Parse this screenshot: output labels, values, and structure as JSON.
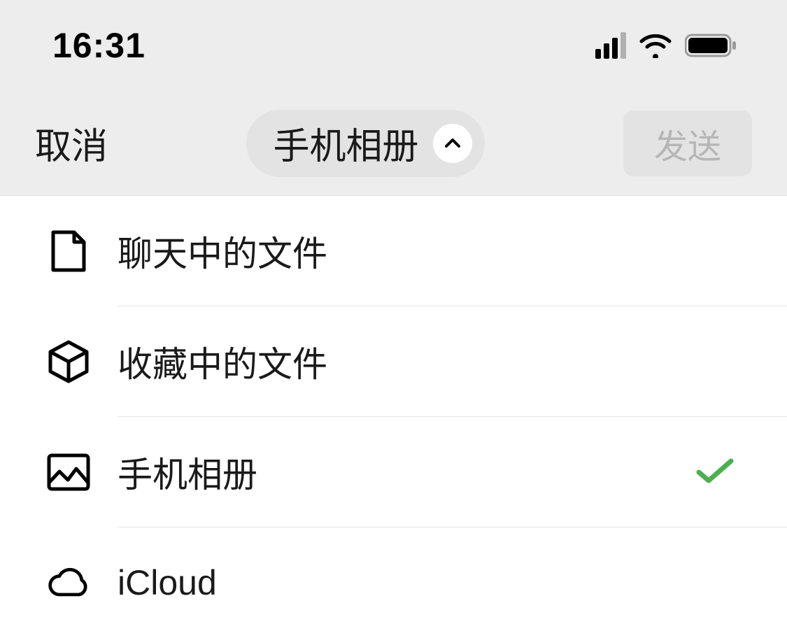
{
  "status": {
    "time": "16:31"
  },
  "nav": {
    "cancel_label": "取消",
    "title": "手机相册",
    "send_label": "发送"
  },
  "menu": {
    "items": [
      {
        "label": "聊天中的文件",
        "icon": "file-icon",
        "selected": false
      },
      {
        "label": "收藏中的文件",
        "icon": "cube-icon",
        "selected": false
      },
      {
        "label": "手机相册",
        "icon": "image-icon",
        "selected": true
      },
      {
        "label": "iCloud",
        "icon": "cloud-icon",
        "selected": false
      }
    ]
  },
  "colors": {
    "check_green": "#4caf50"
  }
}
